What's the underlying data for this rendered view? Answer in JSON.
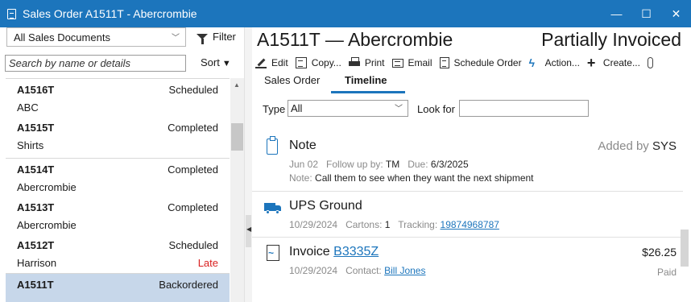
{
  "window": {
    "title": "Sales Order A1511T - Abercrombie",
    "minimize": "—",
    "maximize": "☐",
    "close": "✕"
  },
  "left": {
    "doc_filter_value": "All Sales Documents",
    "filter_label": "Filter",
    "search_placeholder": "Search by name or details",
    "sort_label": "Sort",
    "orders": [
      {
        "number": "A1516T",
        "status": "Scheduled",
        "customer": "ABC",
        "flag": ""
      },
      {
        "number": "A1515T",
        "status": "Completed",
        "customer": "Shirts",
        "flag": ""
      },
      {
        "number": "A1514T",
        "status": "Completed",
        "customer": "Abercrombie",
        "flag": ""
      },
      {
        "number": "A1513T",
        "status": "Completed",
        "customer": "Abercrombie",
        "flag": ""
      },
      {
        "number": "A1512T",
        "status": "Scheduled",
        "customer": "Harrison",
        "flag": "Late"
      },
      {
        "number": "A1511T",
        "status": "Backordered",
        "customer": "",
        "flag": ""
      }
    ]
  },
  "header": {
    "order_title": "A1511T — Abercrombie",
    "order_status": "Partially Invoiced"
  },
  "toolbar": {
    "edit": "Edit",
    "copy": "Copy...",
    "print": "Print",
    "email": "Email",
    "schedule": "Schedule Order",
    "action": "Action...",
    "create": "Create..."
  },
  "tabs": {
    "sales_order": "Sales Order",
    "timeline": "Timeline"
  },
  "filters": {
    "type_label": "Type",
    "type_value": "All",
    "look_for_label": "Look for",
    "look_for_value": ""
  },
  "timeline": {
    "note": {
      "title": "Note",
      "added_by_label": "Added by",
      "added_by": "SYS",
      "date": "Jun 02",
      "follow_label": "Follow up by:",
      "follow_value": "TM",
      "due_label": "Due:",
      "due_value": "6/3/2025",
      "note_label": "Note:",
      "note_text": "Call them to see when they want the next shipment"
    },
    "shipment": {
      "title": "UPS Ground",
      "date": "10/29/2024",
      "cartons_label": "Cartons:",
      "cartons_value": "1",
      "tracking_label": "Tracking:",
      "tracking_value": "19874968787"
    },
    "invoice": {
      "title": "Invoice",
      "invoice_number": "B3335Z",
      "amount": "$26.25",
      "date": "10/29/2024",
      "contact_label": "Contact:",
      "contact_value": "Bill Jones",
      "state": "Paid"
    }
  },
  "colors": {
    "accent": "#1c75bc",
    "selected_row": "#c7d7ea",
    "late": "#d92020"
  }
}
